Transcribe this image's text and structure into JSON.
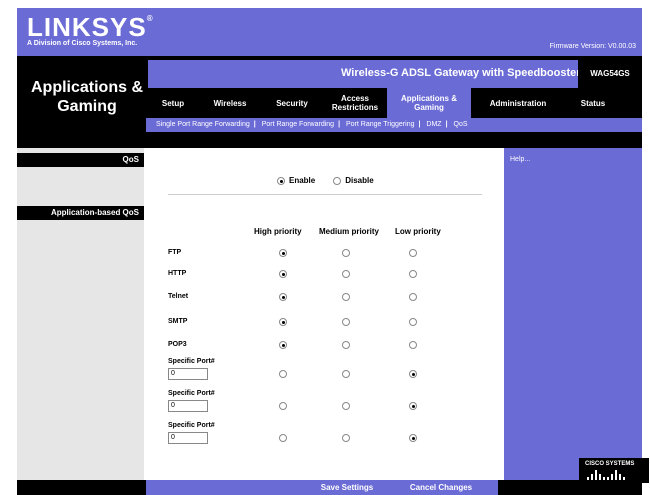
{
  "header": {
    "logo": "LINKSYS",
    "logo_mark": "®",
    "tagline": "A Division of Cisco Systems, Inc.",
    "firmware": "Firmware Version: V0.00.03",
    "section_title": "Applications & Gaming",
    "product_name": "Wireless-G ADSL Gateway with Speedbooster",
    "model": "WAG54GS"
  },
  "tabs": [
    {
      "label": "Setup",
      "active": false
    },
    {
      "label": "Wireless",
      "active": false
    },
    {
      "label": "Security",
      "active": false
    },
    {
      "label": "Access Restrictions",
      "active": false
    },
    {
      "label": "Applications & Gaming",
      "active": true
    },
    {
      "label": "Administration",
      "active": false
    },
    {
      "label": "Status",
      "active": false
    }
  ],
  "subtabs": [
    "Single Port Range Forwarding",
    "Port Range Forwarding",
    "Port Range Triggering",
    "DMZ",
    "QoS"
  ],
  "sidebar": {
    "qos": "QoS",
    "app_qos": "Application-based QoS"
  },
  "qos": {
    "enable_label": "Enable",
    "disable_label": "Disable",
    "enabled": true
  },
  "priority_headers": [
    "High priority",
    "Medium priority",
    "Low priority"
  ],
  "apps": [
    {
      "label": "FTP",
      "priority": "high"
    },
    {
      "label": "HTTP",
      "priority": "high"
    },
    {
      "label": "Telnet",
      "priority": "high"
    },
    {
      "label": "SMTP",
      "priority": "high"
    },
    {
      "label": "POP3",
      "priority": "high"
    },
    {
      "label": "Specific Port#",
      "port": "0",
      "priority": "low"
    },
    {
      "label": "Specific Port#",
      "port": "0",
      "priority": "low"
    },
    {
      "label": "Specific Port#",
      "port": "0",
      "priority": "low"
    }
  ],
  "help": {
    "label": "Help..."
  },
  "cisco": {
    "label": "CISCO SYSTEMS"
  },
  "buttons": {
    "save": "Save Settings",
    "cancel": "Cancel Changes"
  },
  "colors": {
    "brand_blue": "#6b6bd6",
    "black": "#000000",
    "sidebar_gray": "#e6e6e6"
  }
}
